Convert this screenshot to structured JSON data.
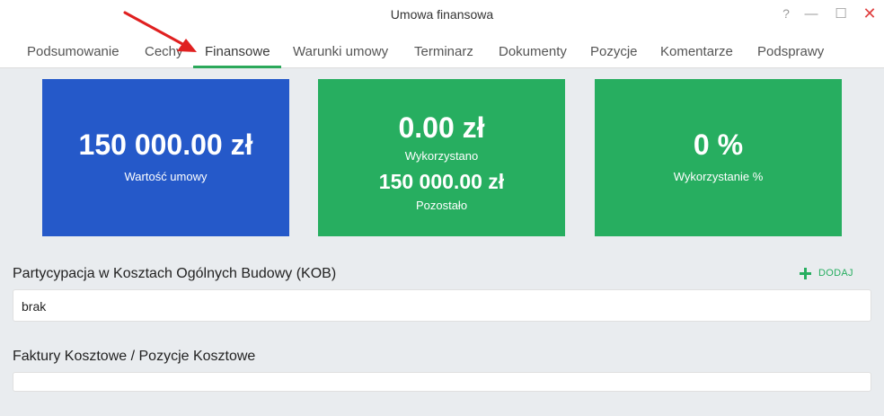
{
  "window": {
    "title": "Umowa finansowa",
    "help": "?",
    "minimize": "—",
    "maximize": "☐",
    "close": "✕"
  },
  "tabs": [
    {
      "label": "Podsumowanie"
    },
    {
      "label": "Cechy"
    },
    {
      "label": "Finansowe",
      "active": true
    },
    {
      "label": "Warunki umowy"
    },
    {
      "label": "Terminarz"
    },
    {
      "label": "Dokumenty"
    },
    {
      "label": "Pozycje"
    },
    {
      "label": "Komentarze"
    },
    {
      "label": "Podsprawy"
    }
  ],
  "cards": {
    "contract_value": {
      "value": "150 000.00 zł",
      "label": "Wartość umowy",
      "color": "#2559c9"
    },
    "usage": {
      "used_value": "0.00 zł",
      "used_label": "Wykorzystano",
      "remaining_value": "150 000.00 zł",
      "remaining_label": "Pozostało",
      "color": "#27ae60"
    },
    "usage_percent": {
      "value": "0 %",
      "label": "Wykorzystanie %",
      "color": "#27ae60"
    }
  },
  "kob": {
    "title": "Partycypacja w Kosztach Ogólnych Budowy (KOB)",
    "add_label": "DODAJ",
    "value": "brak"
  },
  "invoices": {
    "title": "Faktury Kosztowe / Pozycje Kosztowe",
    "value": ""
  },
  "annotation": {
    "color": "#e02020"
  }
}
